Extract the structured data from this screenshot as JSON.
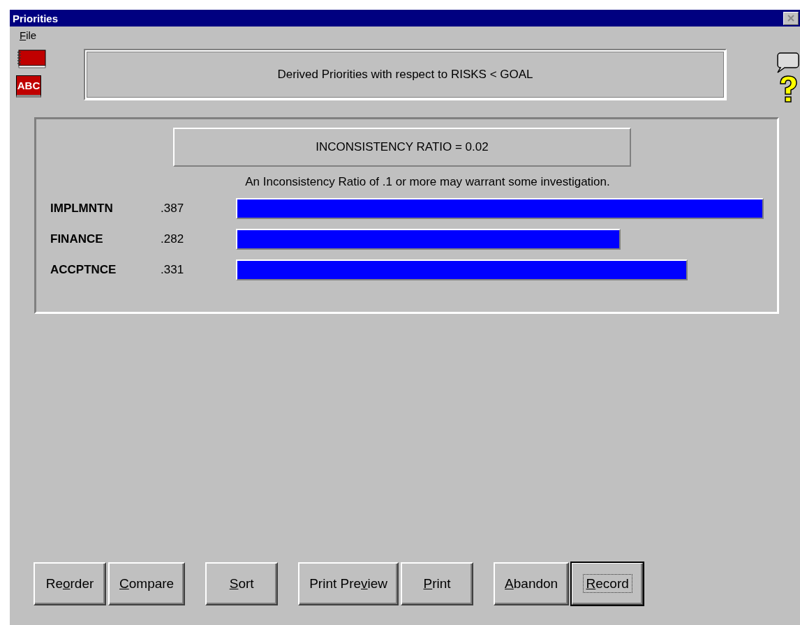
{
  "window": {
    "title": "Priorities"
  },
  "menu": [
    {
      "mnemonic": "F",
      "label_after": "ile"
    }
  ],
  "spellcheck_icon_text": "ABC",
  "header": "Derived Priorities with respect to RISKS < GOAL",
  "ratio": "INCONSISTENCY RATIO = 0.02",
  "note": "An Inconsistency Ratio of .1 or more may warrant some investigation.",
  "priorities": [
    {
      "name": "IMPLMNTN",
      "value": ".387"
    },
    {
      "name": "FINANCE",
      "value": ".282"
    },
    {
      "name": "ACCPTNCE",
      "value": ".331"
    }
  ],
  "button_groups": [
    [
      {
        "label_before": "Re",
        "mnemonic": "o",
        "label_after": "rder",
        "default": false
      },
      {
        "mnemonic": "C",
        "label_after": "ompare",
        "default": false
      }
    ],
    [
      {
        "mnemonic": "S",
        "label_after": "ort",
        "default": false
      }
    ],
    [
      {
        "label_before": "Print Pre",
        "mnemonic": "v",
        "label_after": "iew",
        "default": false
      },
      {
        "mnemonic": "P",
        "label_after": "rint",
        "default": false
      }
    ],
    [
      {
        "mnemonic": "A",
        "label_after": "bandon",
        "default": false
      },
      {
        "mnemonic": "R",
        "label_after": "ecord",
        "default": true
      }
    ]
  ]
}
